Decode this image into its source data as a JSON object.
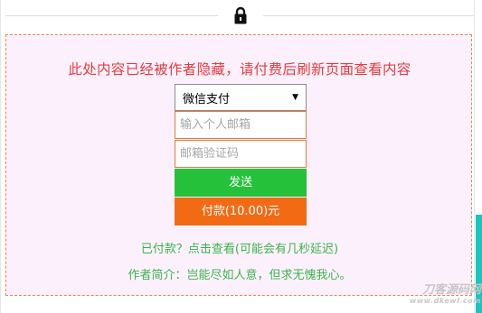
{
  "notice": "此处内容已经被作者隐藏，请付费后刷新页面查看内容",
  "payment_select": {
    "value": "微信支付",
    "arrow": "▼"
  },
  "email_input": {
    "placeholder": "输入个人邮箱",
    "value": ""
  },
  "code_input": {
    "placeholder": "邮箱验证码",
    "value": ""
  },
  "send_button": "发送",
  "pay_button": "付款(10.00)元",
  "paid_link": "已付款？点击查看(可能会有几秒延迟)",
  "author_intro": "作者简介：岂能尽如人意，但求无愧我心。",
  "watermark": {
    "name": "刀客源码网",
    "url": "www.dkewl.com"
  },
  "colors": {
    "notice": "#e53c3c",
    "send": "#26c13b",
    "pay": "#f26b14",
    "green_text": "#39b54a",
    "box_bg": "#fdf0fd",
    "box_border": "#e8894a"
  },
  "icons": {
    "lock": "lock-icon"
  }
}
